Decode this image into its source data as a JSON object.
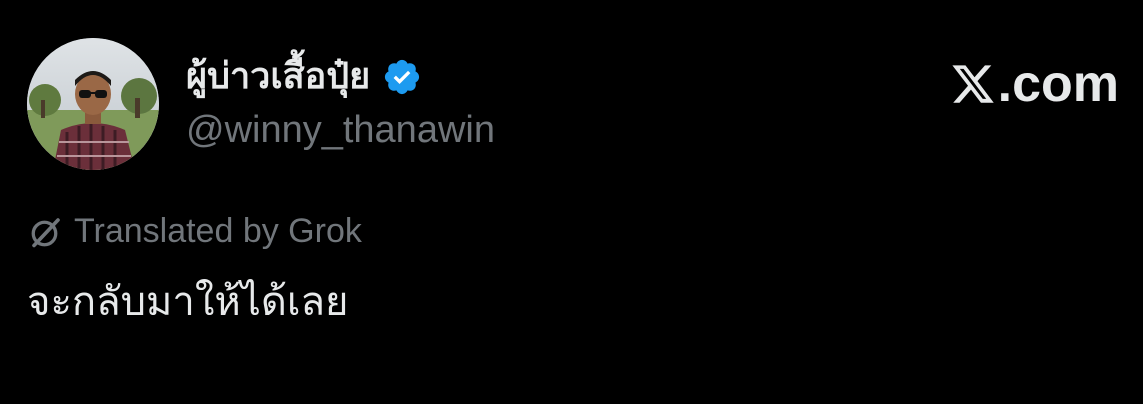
{
  "author": {
    "display_name": "ผู้บ่าวเสื้อปุ๋ย",
    "handle": "@winny_thanawin",
    "verified_badge_icon": "verified-badge-icon",
    "verified_color": "#1d9bf0",
    "avatar_icon": "profile-photo"
  },
  "site": {
    "label": ".com",
    "logo_icon": "x-logo-icon"
  },
  "translation": {
    "label": "Translated by Grok",
    "icon": "grok-icon"
  },
  "post": {
    "text": "จะกลับมาให้ได้เลย"
  },
  "colors": {
    "background": "#000000",
    "primary_text": "#e7e9ea",
    "secondary_text": "#71767b",
    "verified_blue": "#1d9bf0"
  }
}
